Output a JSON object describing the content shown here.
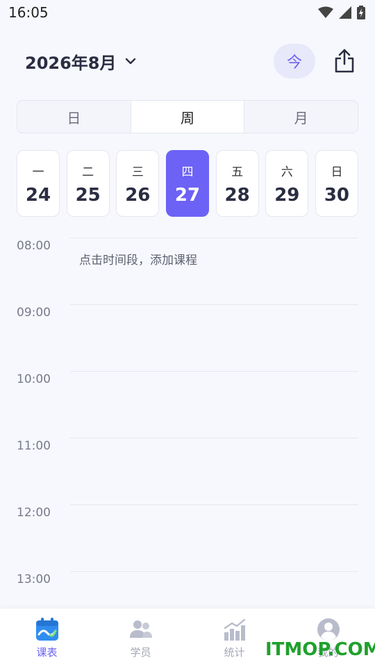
{
  "status_bar": {
    "time": "16:05"
  },
  "header": {
    "month_title": "2026年8月",
    "today_label": "今"
  },
  "view_tabs": [
    {
      "label": "日",
      "active": false
    },
    {
      "label": "周",
      "active": true
    },
    {
      "label": "月",
      "active": false
    }
  ],
  "week_days": [
    {
      "weekday": "一",
      "date": "24"
    },
    {
      "weekday": "二",
      "date": "25"
    },
    {
      "weekday": "三",
      "date": "26"
    },
    {
      "weekday": "四",
      "date": "27",
      "selected": true
    },
    {
      "weekday": "五",
      "date": "28"
    },
    {
      "weekday": "六",
      "date": "29"
    },
    {
      "weekday": "日",
      "date": "30"
    }
  ],
  "timeline": {
    "hours": [
      "08:00",
      "09:00",
      "10:00",
      "11:00",
      "12:00",
      "13:00"
    ],
    "add_hint": "点击时间段，添加课程"
  },
  "bottom_nav": [
    {
      "label": "课表",
      "icon": "calendar-icon",
      "active": true
    },
    {
      "label": "学员",
      "icon": "people-icon",
      "active": false
    },
    {
      "label": "统计",
      "icon": "chart-icon",
      "active": false
    },
    {
      "label": "我的",
      "icon": "profile-icon",
      "active": false
    }
  ],
  "watermark": "ITMOP.COM",
  "colors": {
    "accent": "#6c62f5",
    "today_bg": "#e8e8fb",
    "background": "#f7f8fd"
  }
}
